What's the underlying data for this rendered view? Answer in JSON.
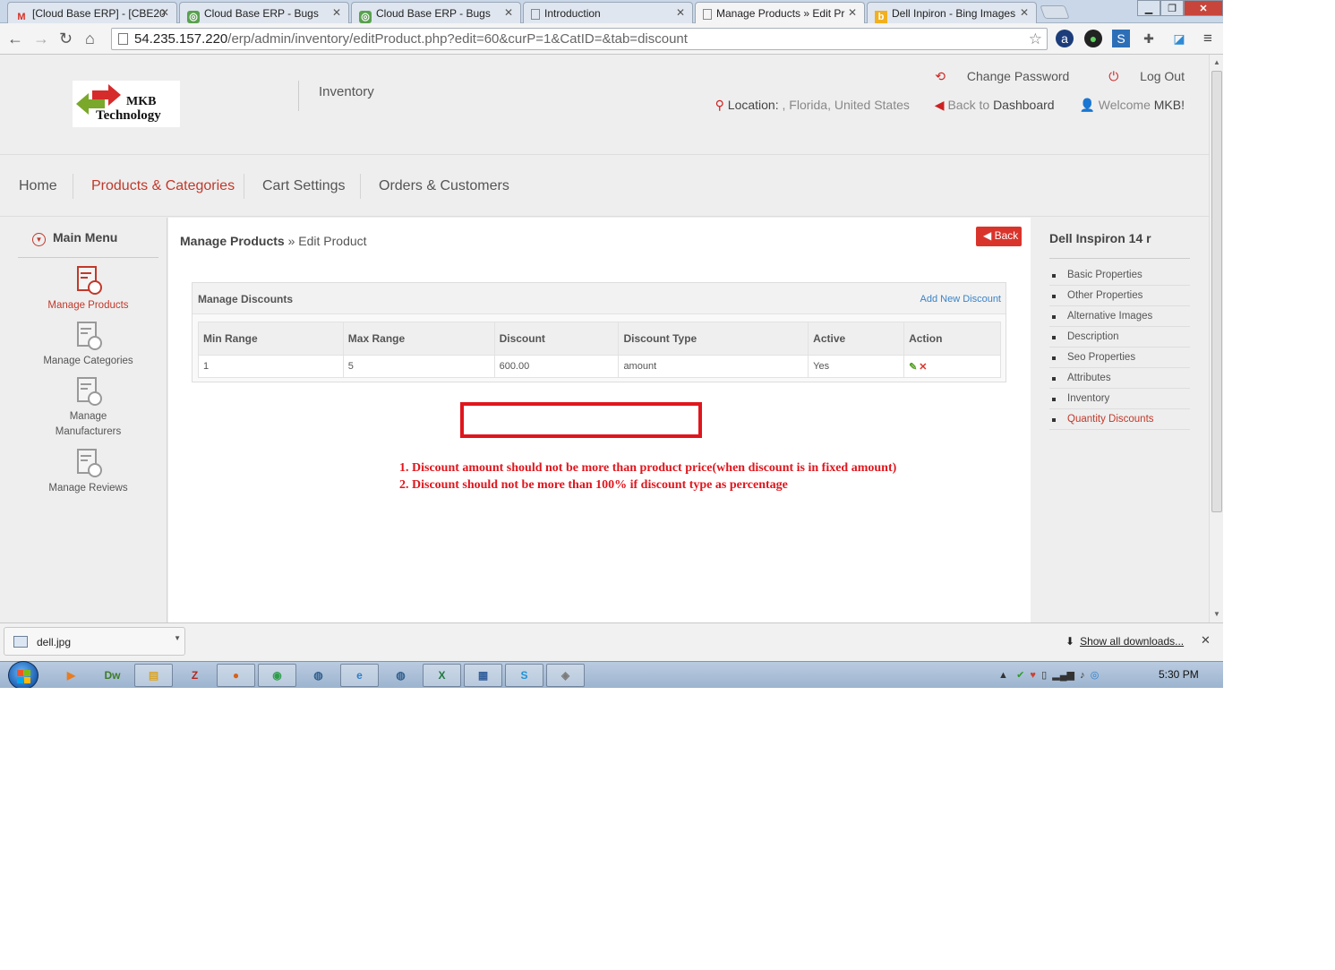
{
  "browser": {
    "tabs": [
      {
        "title": "[Cloud Base ERP] - [CBE20",
        "icon": "gmail-icon",
        "active": false
      },
      {
        "title": "Cloud Base ERP - Bugs",
        "icon": "bug-tracker-icon",
        "active": false
      },
      {
        "title": "Cloud Base ERP - Bugs",
        "icon": "bug-tracker-icon",
        "active": false
      },
      {
        "title": "Introduction",
        "icon": "page-icon",
        "active": false
      },
      {
        "title": "Manage Products » Edit Pr",
        "icon": "page-icon",
        "active": true
      },
      {
        "title": "Dell Inpiron - Bing Images",
        "icon": "bing-icon",
        "active": false
      }
    ],
    "url_host": "54.235.157.220",
    "url_path": "/erp/admin/inventory/editProduct.php?edit=60&curP=1&CatID=&tab=discount"
  },
  "header": {
    "logo_line1": "MKB",
    "logo_line2": "Technology",
    "module": "Inventory",
    "change_password": "Change Password",
    "logout": "Log Out",
    "location_label": "Location:",
    "location_value": " , Florida, United States",
    "back_to": "Back to",
    "dashboard": "Dashboard",
    "welcome": "Welcome",
    "user": "MKB!"
  },
  "mainnav": {
    "items": [
      "Home",
      "Products & Categories",
      "Cart Settings",
      "Orders & Customers"
    ],
    "active": "Products & Categories"
  },
  "sidebar": {
    "title": "Main Menu",
    "items": [
      "Manage Products",
      "Manage Categories",
      "Manage Manufacturers",
      "Manage Reviews"
    ],
    "items_line1": [
      "Manage Products",
      "Manage Categories",
      "Manage",
      "Manage Reviews"
    ],
    "items_line2": [
      "",
      "",
      "Manufacturers",
      ""
    ],
    "active": "Manage Products"
  },
  "content": {
    "crumb_section": "Manage Products",
    "crumb_sep": "»",
    "crumb_page": "Edit Product",
    "back_label": "Back",
    "panel_title": "Manage Discounts",
    "add_link": "Add New Discount",
    "columns": [
      "Min Range",
      "Max Range",
      "Discount",
      "Discount Type",
      "Active",
      "Action"
    ],
    "rows": [
      {
        "min": "1",
        "max": "5",
        "discount": "600.00",
        "type": "amount",
        "active": "Yes"
      }
    ],
    "notes": [
      "1. Discount amount should not be more than product price(when discount is in fixed amount)",
      "2. Discount should not be more than 100% if discount type as percentage"
    ]
  },
  "rightbar": {
    "product_name": "Dell Inspiron 14 r",
    "items": [
      "Basic Properties",
      "Other Properties",
      "Alternative Images",
      "Description",
      "Seo Properties",
      "Attributes",
      "Inventory",
      "Quantity Discounts"
    ],
    "active": "Quantity Discounts"
  },
  "downloads": {
    "file": "dell.jpg",
    "show_all": "Show all downloads..."
  },
  "taskbar": {
    "clock": "5:30 PM"
  },
  "colors": {
    "accent_red": "#c0392b",
    "link_blue": "#3a83c7",
    "annotation_red": "#e0161d"
  }
}
